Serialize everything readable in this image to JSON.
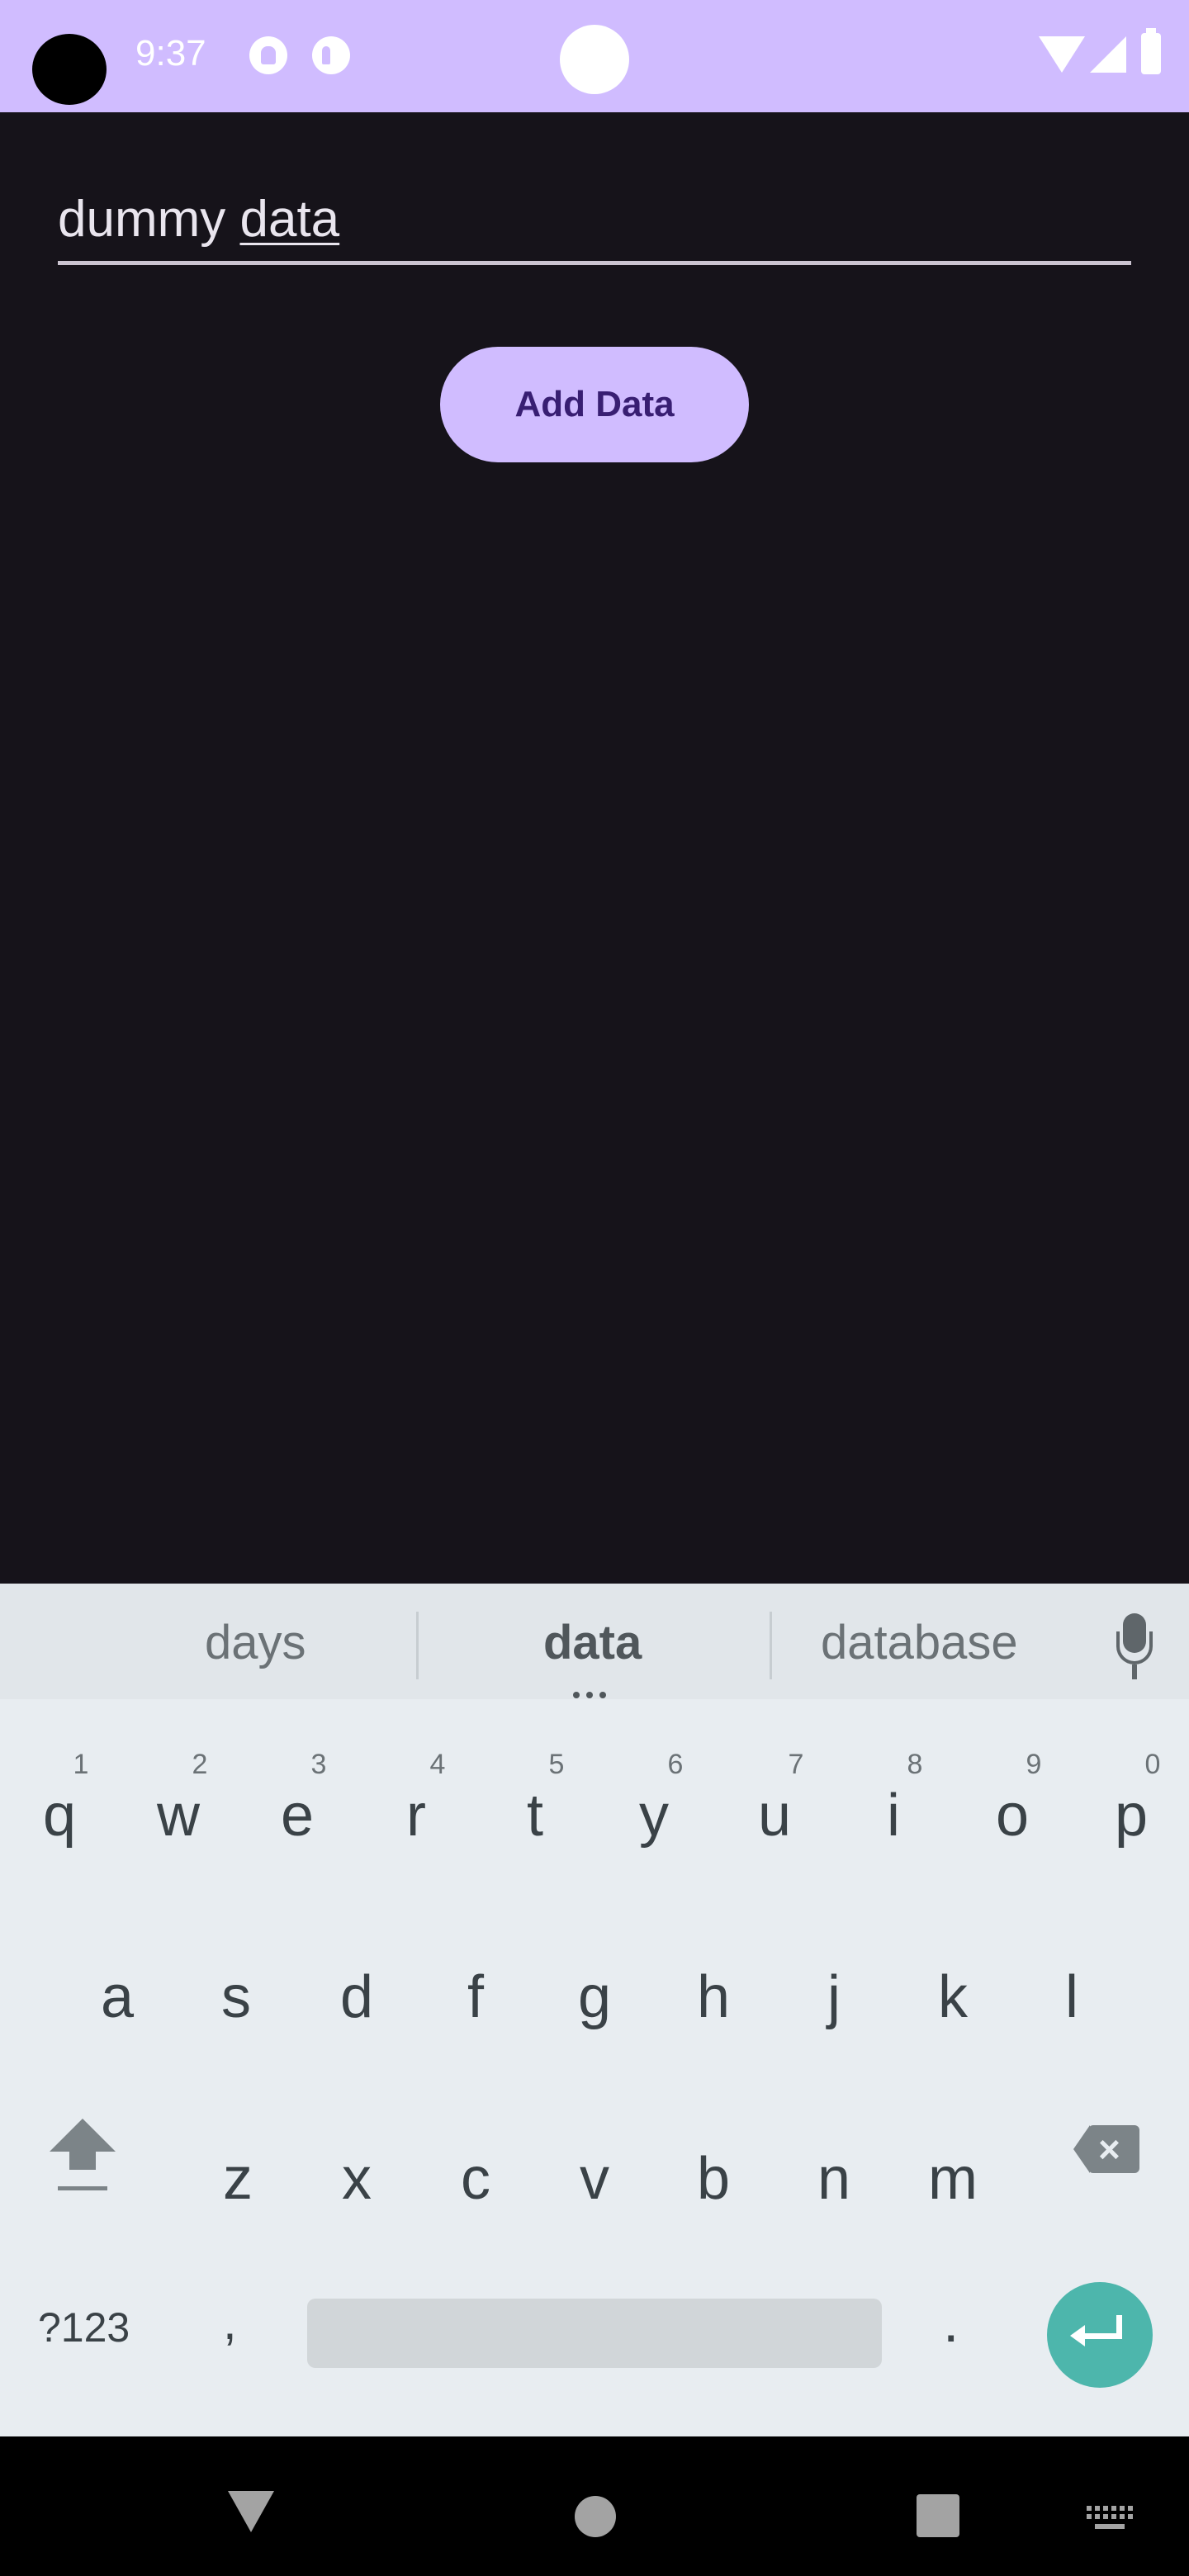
{
  "status_bar": {
    "time": "9:37",
    "background": "#d0bcff",
    "icons": [
      "notification-icon",
      "app-icon",
      "wifi-icon",
      "signal-icon",
      "battery-icon"
    ]
  },
  "app": {
    "background": "#16131a",
    "input": {
      "value": "dummy data",
      "value_plain": "dummy ",
      "value_composing": "data"
    },
    "add_button_label": "Add Data",
    "accent": "#d0bcff"
  },
  "keyboard": {
    "suggestions": [
      "days",
      "data",
      "database"
    ],
    "rows": [
      {
        "keys": [
          "q",
          "w",
          "e",
          "r",
          "t",
          "y",
          "u",
          "i",
          "o",
          "p"
        ],
        "hints": [
          "1",
          "2",
          "3",
          "4",
          "5",
          "6",
          "7",
          "8",
          "9",
          "0"
        ]
      },
      {
        "keys": [
          "a",
          "s",
          "d",
          "f",
          "g",
          "h",
          "j",
          "k",
          "l"
        ]
      },
      {
        "keys": [
          "z",
          "x",
          "c",
          "v",
          "b",
          "n",
          "m"
        ]
      }
    ],
    "symbols_label": "?123",
    "comma": ",",
    "period": ".",
    "enter_color": "#4db6ac"
  },
  "nav_bar": {
    "icons": [
      "back-icon",
      "home-icon",
      "recents-icon",
      "keyboard-switch-icon"
    ]
  }
}
